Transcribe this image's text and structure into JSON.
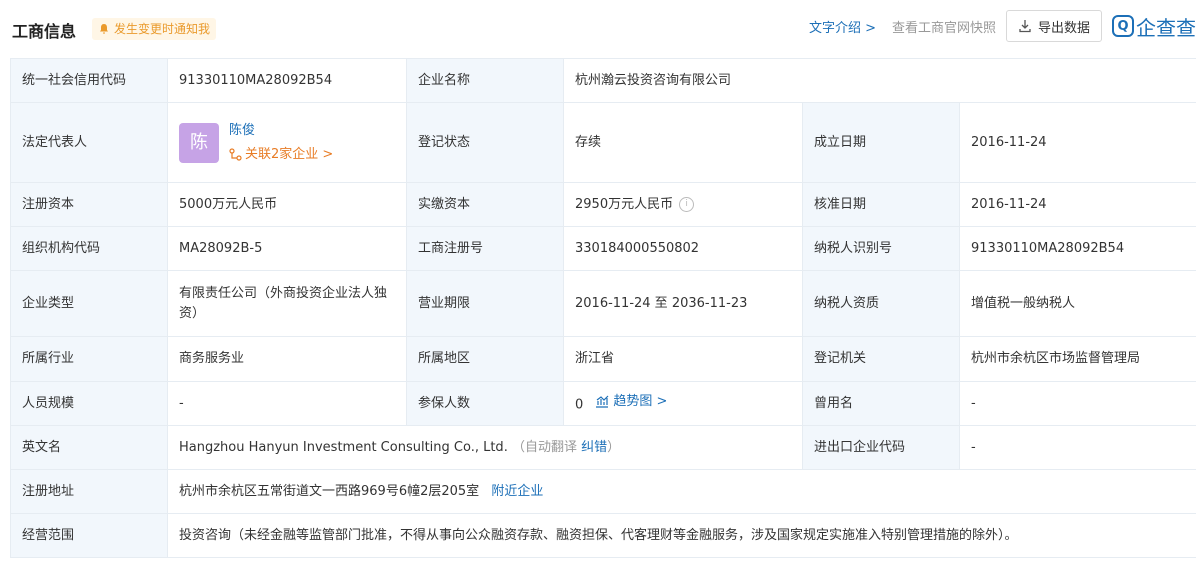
{
  "header": {
    "title": "工商信息",
    "notify_label": "发生变更时通知我",
    "intro_link": "文字介绍 >",
    "snapshot_link": "查看工商官网快照",
    "export_label": "导出数据",
    "logo_text": "企查查",
    "logo_mark": "Q"
  },
  "colors": {
    "accent": "#1c6fb7",
    "label_bg": "#f2f7fc",
    "border": "#e6ecf2",
    "orange": "#e87c25",
    "avatar": "#c6a3e6"
  },
  "rows": {
    "credit_code": {
      "label": "统一社会信用代码",
      "value": "91330110MA28092B54"
    },
    "company_name": {
      "label": "企业名称",
      "value": "杭州瀚云投资咨询有限公司"
    },
    "legal_rep": {
      "label": "法定代表人",
      "avatar": "陈",
      "name": "陈俊",
      "related": "关联2家企业 >"
    },
    "reg_status": {
      "label": "登记状态",
      "value": "存续"
    },
    "est_date": {
      "label": "成立日期",
      "value": "2016-11-24"
    },
    "reg_capital": {
      "label": "注册资本",
      "value": "5000万元人民币"
    },
    "paid_capital": {
      "label": "实缴资本",
      "value": "2950万元人民币"
    },
    "approve_date": {
      "label": "核准日期",
      "value": "2016-11-24"
    },
    "org_code": {
      "label": "组织机构代码",
      "value": "MA28092B-5"
    },
    "biz_reg_no": {
      "label": "工商注册号",
      "value": "330184000550802"
    },
    "taxpayer_id": {
      "label": "纳税人识别号",
      "value": "91330110MA28092B54"
    },
    "company_type": {
      "label": "企业类型",
      "value": "有限责任公司（外商投资企业法人独资）"
    },
    "biz_term": {
      "label": "营业期限",
      "value": "2016-11-24 至 2036-11-23"
    },
    "taxpayer_qual": {
      "label": "纳税人资质",
      "value": "增值税一般纳税人"
    },
    "industry": {
      "label": "所属行业",
      "value": "商务服务业"
    },
    "region": {
      "label": "所属地区",
      "value": "浙江省"
    },
    "reg_authority": {
      "label": "登记机关",
      "value": "杭州市余杭区市场监督管理局"
    },
    "staff_size": {
      "label": "人员规模",
      "value": "-"
    },
    "insured": {
      "label": "参保人数",
      "value": "0",
      "trend": "趋势图 >"
    },
    "former_name": {
      "label": "曾用名",
      "value": "-"
    },
    "english_name": {
      "label": "英文名",
      "value": "Hangzhou Hanyun Investment Consulting Co., Ltd.",
      "auto_translate": "（自动翻译",
      "correct": "纠错",
      "close_paren": "）"
    },
    "import_export": {
      "label": "进出口企业代码",
      "value": "-"
    },
    "address": {
      "label": "注册地址",
      "value": "杭州市余杭区五常街道文一西路969号6幢2层205室",
      "nearby": "附近企业"
    },
    "scope": {
      "label": "经营范围",
      "value": "投资咨询（未经金融等监管部门批准，不得从事向公众融资存款、融资担保、代客理财等金融服务，涉及国家规定实施准入特别管理措施的除外）。"
    }
  }
}
